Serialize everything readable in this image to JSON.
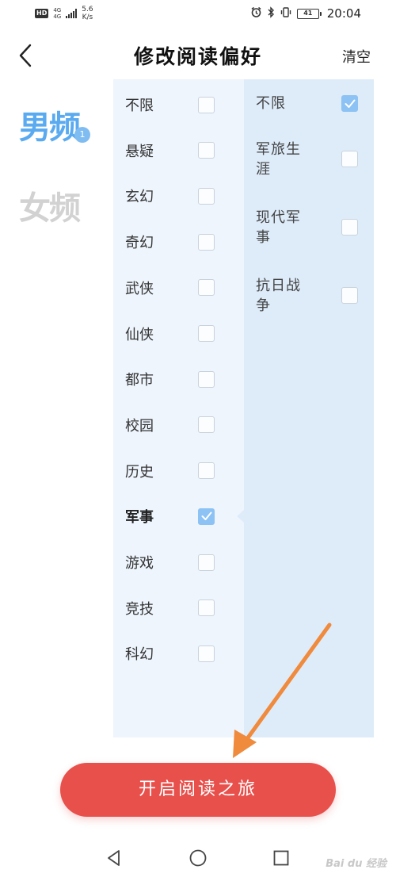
{
  "status_bar": {
    "hd": "HD",
    "network_top": "4G",
    "network_bottom": "4G",
    "speed_value": "5.6",
    "speed_unit": "K/s",
    "battery": "41",
    "time": "20:04"
  },
  "header": {
    "title": "修改阅读偏好",
    "clear_label": "清空"
  },
  "gender_tabs": {
    "male": "男频",
    "female": "女频",
    "male_count": "1"
  },
  "categories": [
    {
      "label": "不限",
      "checked": false
    },
    {
      "label": "悬疑",
      "checked": false
    },
    {
      "label": "玄幻",
      "checked": false
    },
    {
      "label": "奇幻",
      "checked": false
    },
    {
      "label": "武侠",
      "checked": false
    },
    {
      "label": "仙侠",
      "checked": false
    },
    {
      "label": "都市",
      "checked": false
    },
    {
      "label": "校园",
      "checked": false
    },
    {
      "label": "历史",
      "checked": false
    },
    {
      "label": "军事",
      "checked": true
    },
    {
      "label": "游戏",
      "checked": false
    },
    {
      "label": "竞技",
      "checked": false
    },
    {
      "label": "科幻",
      "checked": false
    }
  ],
  "subcategories": [
    {
      "line1": "不限",
      "line2": "",
      "checked": true
    },
    {
      "line1": "军旅生",
      "line2": "涯",
      "checked": false
    },
    {
      "line1": "现代军",
      "line2": "事",
      "checked": false
    },
    {
      "line1": "抗日战",
      "line2": "争",
      "checked": false
    }
  ],
  "start_button_label": "开启阅读之旅",
  "watermark": "Bai du 经验",
  "colors": {
    "accent_blue": "#5aaaf0",
    "checkbox_checked": "#8cc2f4",
    "left_panel_bg": "#eef5fd",
    "right_panel_bg": "#deecfa",
    "start_button": "#e8504c",
    "annotation_arrow": "#f08a3c"
  }
}
